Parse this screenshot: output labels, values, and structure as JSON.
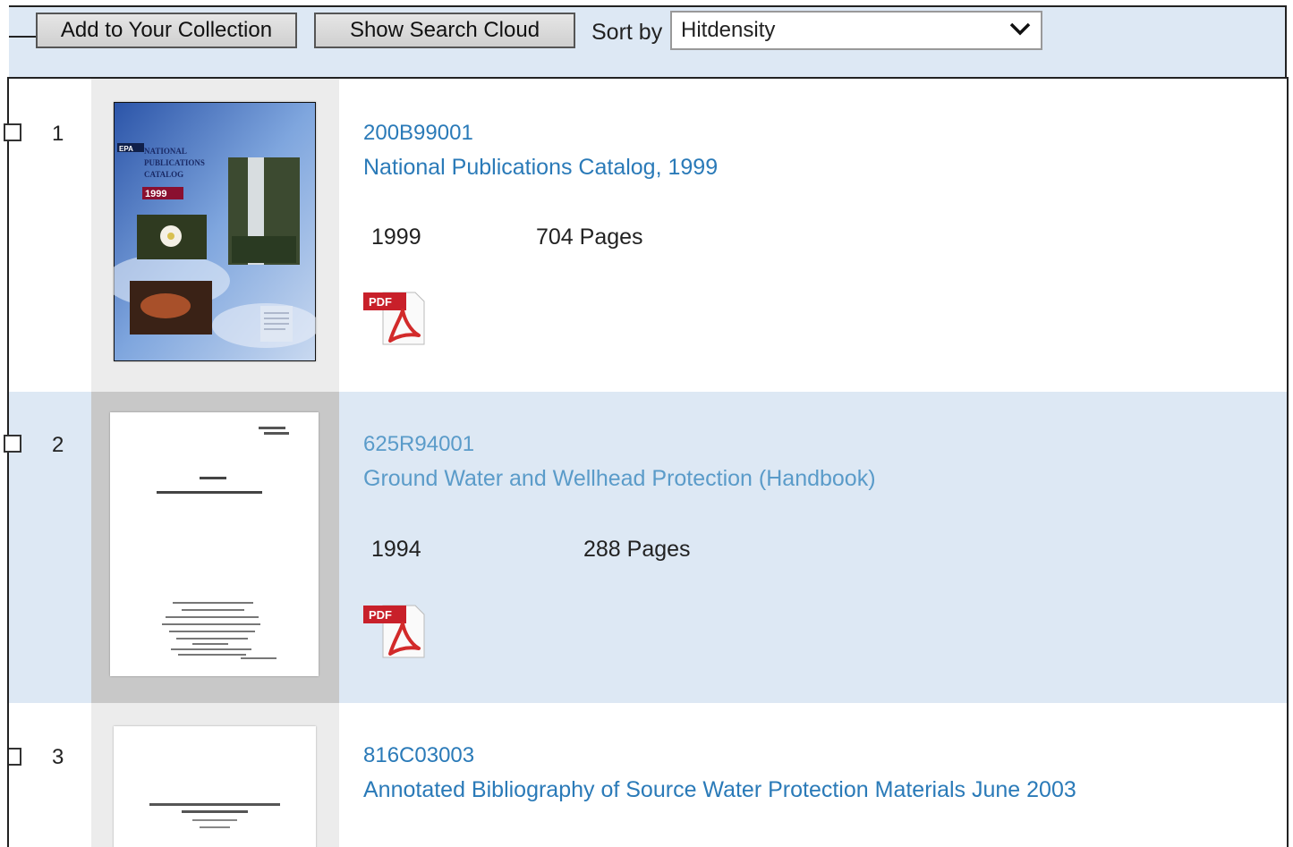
{
  "toolbar": {
    "add_label": "Add to Your Collection",
    "cloud_label": "Show Search Cloud",
    "sort_label": "Sort by",
    "sort_value": "Hitdensity"
  },
  "results": [
    {
      "num": "1",
      "id": "200B99001",
      "title": "National Publications Catalog, 1999",
      "year": "1999",
      "pages": "704 Pages",
      "cover_text": {
        "line1": "NATIONAL",
        "line2": "PUBLICATIONS",
        "line3": "CATALOG",
        "year": "1999"
      }
    },
    {
      "num": "2",
      "id": "625R94001",
      "title": "Ground Water and Wellhead Protection (Handbook)",
      "year": "1994",
      "pages": "288 Pages"
    },
    {
      "num": "3",
      "id": "816C03003",
      "title": "Annotated Bibliography of Source Water Protection Materials June 2003"
    }
  ],
  "pdf_badge": "PDF",
  "colors": {
    "link": "#2a7ab8",
    "row_alt": "#dde8f4",
    "toolbar_bg": "#dde8f4"
  }
}
